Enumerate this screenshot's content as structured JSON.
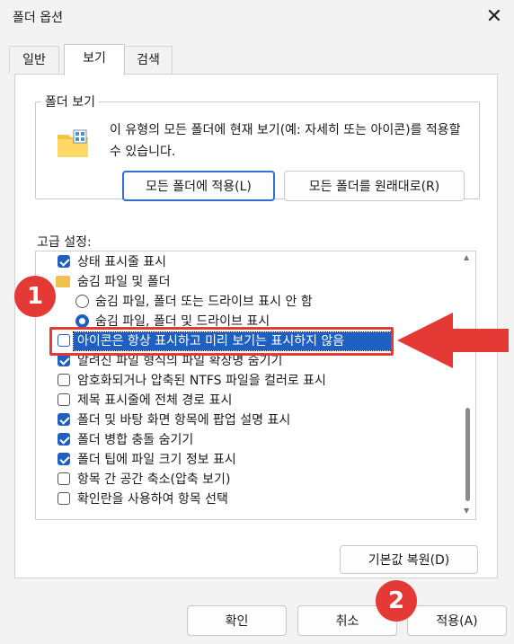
{
  "window": {
    "title": "폴더 옵션",
    "close_glyph": "✕"
  },
  "tabs": [
    {
      "label": "일반",
      "active": false
    },
    {
      "label": "보기",
      "active": true
    },
    {
      "label": "검색",
      "active": false
    }
  ],
  "folder_view": {
    "legend": "폴더 보기",
    "description": "이 유형의 모든 폴더에 현재 보기(예: 자세히 또는 아이콘)를 적용할 수 있습니다.",
    "apply_button": "모든 폴더에 적용(L)",
    "reset_button": "모든 폴더를 원래대로(R)"
  },
  "advanced": {
    "label": "고급 설정:",
    "items": [
      {
        "type": "checkbox",
        "checked": true,
        "indent": 0,
        "label": "상태 표시줄 표시"
      },
      {
        "type": "folder",
        "indent": 0,
        "label": "숨김 파일 및 폴더"
      },
      {
        "type": "radio",
        "checked": false,
        "indent": 1,
        "label": "숨김 파일, 폴더 또는 드라이브 표시 안 함"
      },
      {
        "type": "radio",
        "checked": true,
        "indent": 1,
        "label": "숨김 파일, 폴더 및 드라이브 표시"
      },
      {
        "type": "checkbox",
        "checked": true,
        "indent": 0,
        "selected": true,
        "label": "아이콘은 항상 표시하고 미리 보기는 표시하지 않음"
      },
      {
        "type": "checkbox",
        "checked": true,
        "indent": 0,
        "label": "알려진 파일 형식의 파일 확장명 숨기기"
      },
      {
        "type": "checkbox",
        "checked": false,
        "indent": 0,
        "label": "암호화되거나 압축된 NTFS 파일을 컬러로 표시"
      },
      {
        "type": "checkbox",
        "checked": false,
        "indent": 0,
        "label": "제목 표시줄에 전체 경로 표시"
      },
      {
        "type": "checkbox",
        "checked": true,
        "indent": 0,
        "label": "폴더 및 바탕 화면 항목에 팝업 설명 표시"
      },
      {
        "type": "checkbox",
        "checked": true,
        "indent": 0,
        "label": "폴더 병합 충돌 숨기기"
      },
      {
        "type": "checkbox",
        "checked": true,
        "indent": 0,
        "label": "폴더 팁에 파일 크기 정보 표시"
      },
      {
        "type": "checkbox",
        "checked": false,
        "indent": 0,
        "label": "항목 간 공간 축소(압축 보기)"
      },
      {
        "type": "checkbox",
        "checked": false,
        "indent": 0,
        "label": "확인란을 사용하여 항목 선택"
      }
    ],
    "restore_button": "기본값 복원(D)"
  },
  "footer": {
    "ok": "확인",
    "cancel": "취소",
    "apply": "적용(A)"
  },
  "annotations": {
    "step1": "1",
    "step2": "2",
    "color": "#e53935"
  }
}
